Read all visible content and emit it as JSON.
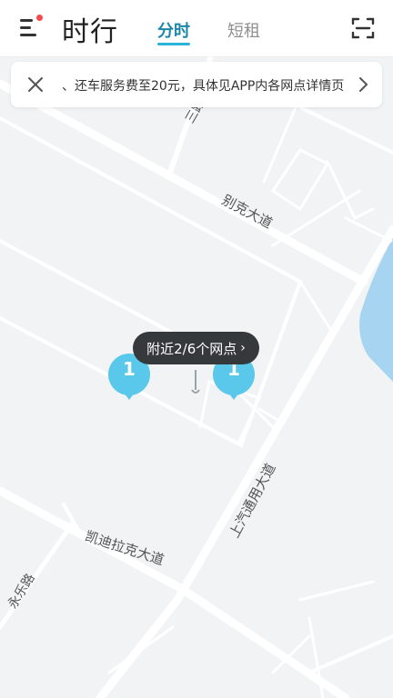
{
  "header": {
    "title": "时行",
    "tabs": [
      {
        "label": "分时",
        "active": true
      },
      {
        "label": "短租",
        "active": false
      }
    ]
  },
  "notice": {
    "text": "、还车服务费至20元，具体见APP内各网点详情页"
  },
  "map": {
    "road_labels": {
      "biek": "别克大道",
      "kaidi": "凯迪拉克大道",
      "shangqi": "上汽通用大道",
      "yongle": "永乐路",
      "san": "三路"
    },
    "tooltip": {
      "text": "附近2/6个网点",
      "chevron": "›"
    },
    "pins": [
      {
        "count": "1"
      },
      {
        "count": "1"
      }
    ]
  },
  "colors": {
    "accent": "#2ab3da",
    "pin": "#5ac8ea",
    "water": "#a6d4f1",
    "tooltip_bg": "#36393c",
    "notification_dot": "#f14b4b"
  },
  "icons": {
    "menu": "menu-icon",
    "scan": "scan-icon",
    "close": "close-icon",
    "notice_arrow": "chevron-right-icon",
    "locator": "location-marker-icon"
  }
}
